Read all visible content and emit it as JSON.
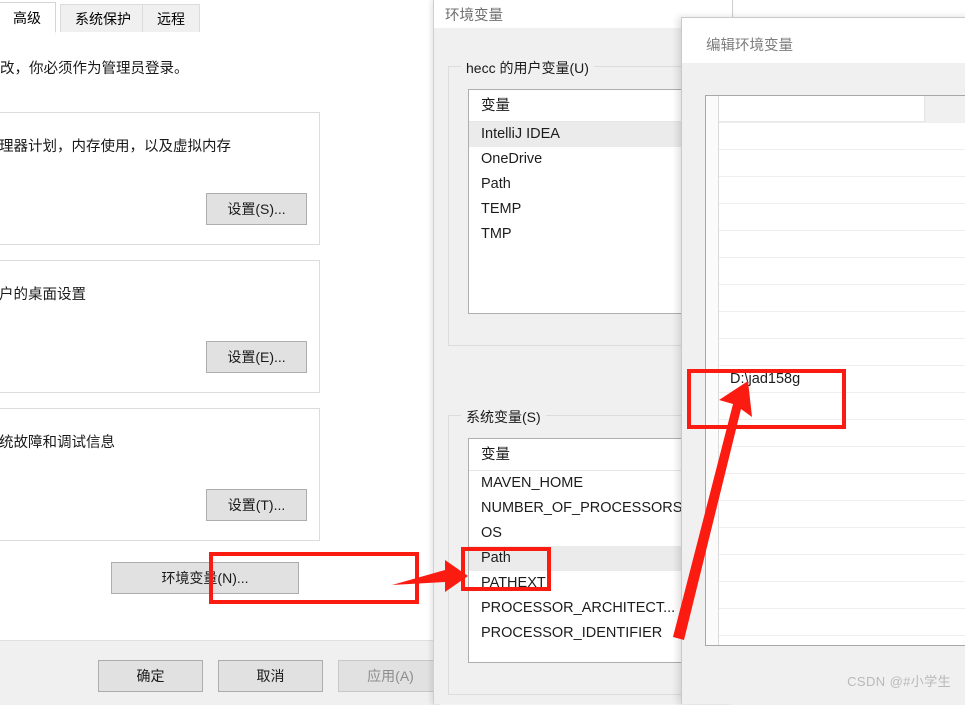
{
  "system_properties": {
    "tabs": [
      {
        "label": "高级",
        "active": true
      },
      {
        "label": "系统保护",
        "active": false
      },
      {
        "label": "远程",
        "active": false
      }
    ],
    "admin_notice": "改，你必须作为管理员登录。",
    "groups": [
      {
        "description": "理器计划，内存使用，以及虚拟内存",
        "button": "设置(S)..."
      },
      {
        "description": "户的桌面设置",
        "button": "设置(E)..."
      },
      {
        "description": "统故障和调试信息",
        "button": "设置(T)..."
      }
    ],
    "env_button": "环境变量(N)...",
    "footer": {
      "ok": "确定",
      "cancel": "取消",
      "apply": "应用(A)"
    }
  },
  "environment_variables": {
    "title": "环境变量",
    "user_group": {
      "label": "hecc 的用户变量(U)",
      "column_header": "变量",
      "rows": [
        {
          "name": "IntelliJ IDEA",
          "selected": true
        },
        {
          "name": "OneDrive",
          "selected": false
        },
        {
          "name": "Path",
          "selected": false
        },
        {
          "name": "TEMP",
          "selected": false
        },
        {
          "name": "TMP",
          "selected": false
        }
      ]
    },
    "system_group": {
      "label": "系统变量(S)",
      "column_header": "变量",
      "rows": [
        {
          "name": "MAVEN_HOME",
          "selected": false
        },
        {
          "name": "NUMBER_OF_PROCESSORS",
          "selected": false
        },
        {
          "name": "OS",
          "selected": false
        },
        {
          "name": "Path",
          "selected": true
        },
        {
          "name": "PATHEXT",
          "selected": false
        },
        {
          "name": "PROCESSOR_ARCHITECT...",
          "selected": false
        },
        {
          "name": "PROCESSOR_IDENTIFIER",
          "selected": false
        }
      ]
    }
  },
  "edit_environment_variable": {
    "title": "编辑环境变量",
    "entries": [
      {
        "value": "",
        "blank": true
      },
      {
        "value": "",
        "blank": true
      },
      {
        "value": "",
        "blank": true
      },
      {
        "value": "",
        "blank": true
      },
      {
        "value": "",
        "blank": true
      },
      {
        "value": "",
        "blank": true
      },
      {
        "value": "",
        "blank": true
      },
      {
        "value": "",
        "blank": true
      },
      {
        "value": "",
        "blank": true
      },
      {
        "value": "",
        "blank": true
      },
      {
        "value": "D:\\jad158g",
        "blank": false
      },
      {
        "value": "",
        "blank": true
      },
      {
        "value": "",
        "blank": true
      },
      {
        "value": "",
        "blank": true
      },
      {
        "value": "",
        "blank": true
      },
      {
        "value": "",
        "blank": true
      },
      {
        "value": "",
        "blank": true
      },
      {
        "value": "",
        "blank": true
      },
      {
        "value": "",
        "blank": true
      },
      {
        "value": "",
        "blank": true
      }
    ]
  },
  "annotations": {
    "color": "#fc1b10",
    "highlight_env_button": "环境变量(N)...",
    "highlight_path_row": "Path",
    "highlight_value": "D:\\jad158g"
  },
  "watermark": "CSDN @#小学生"
}
